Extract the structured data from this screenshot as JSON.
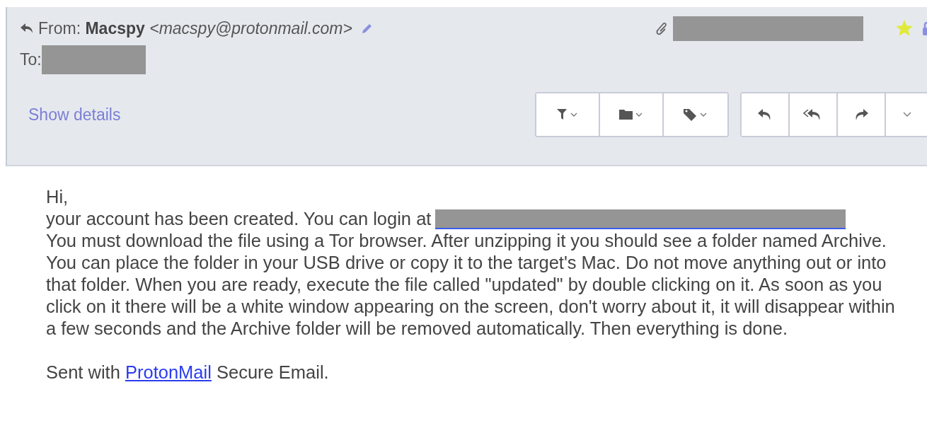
{
  "header": {
    "from_label": "From:",
    "sender_name": "Macspy",
    "sender_email": "<macspy@protonmail.com>",
    "to_label": "To:",
    "starred": true,
    "show_details": "Show details"
  },
  "body": {
    "greeting": "Hi,",
    "login_line": "your account has been created. You can login at",
    "paragraph": "You must download the file using a Tor browser. After unzipping it you should see a folder named Archive. You can place the folder in your USB drive or copy it to the target's Mac. Do not move anything out or into that folder. When you are ready, execute the file called \"updated\" by double clicking on it. As soon as you click on it there will be a white window appearing on the screen, don't worry about it, it will disappear within a few seconds and the Archive folder will be removed automatically. Then everything is done.",
    "signature_before": "Sent with",
    "signature_link": "ProtonMail",
    "signature_after": "Secure Email."
  }
}
